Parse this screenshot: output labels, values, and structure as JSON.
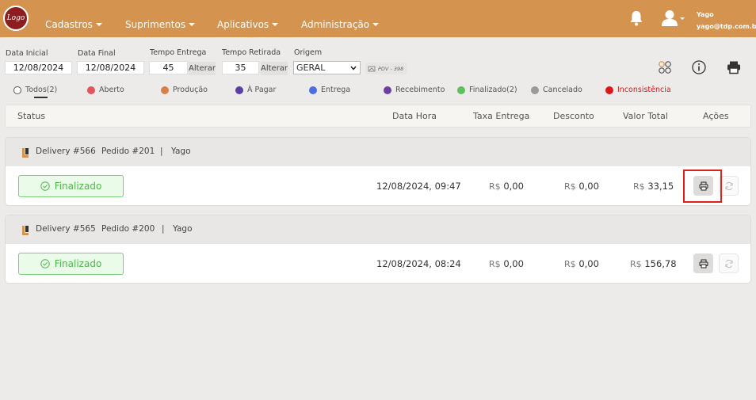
{
  "header": {
    "logo_text": "Logo",
    "menu": [
      "Cadastros",
      "Suprimentos",
      "Aplicativos",
      "Administração"
    ],
    "user_name": "Yago",
    "user_email": "yago@tdp.com.br"
  },
  "filters": {
    "data_inicial_label": "Data Inicial",
    "data_inicial_value": "12/08/2024",
    "data_final_label": "Data Final",
    "data_final_value": "12/08/2024",
    "tempo_entrega_label": "Tempo Entrega",
    "tempo_entrega_value": "45",
    "tempo_retirada_label": "Tempo Retirada",
    "tempo_retirada_value": "35",
    "alterar_label": "Alterar",
    "origem_label": "Origem",
    "origem_value": "GERAL",
    "pdv_label": "PDV - 398"
  },
  "legend": [
    {
      "label": "Todos(2)",
      "color": "#ffffff"
    },
    {
      "label": "Aberto",
      "color": "#e0565a"
    },
    {
      "label": "Produção",
      "color": "#d9804a"
    },
    {
      "label": "À Pagar",
      "color": "#5a3ea8"
    },
    {
      "label": "Entrega",
      "color": "#4a6fe0"
    },
    {
      "label": "Recebimento",
      "color": "#6c3fa0"
    },
    {
      "label": "Finalizado(2)",
      "color": "#5cc05c"
    },
    {
      "label": "Cancelado",
      "color": "#9a9a9a"
    },
    {
      "label": "Inconsistência",
      "color": "#e0151a"
    }
  ],
  "table": {
    "headers": [
      "Status",
      "Data Hora",
      "Taxa Entrega",
      "Desconto",
      "Valor Total",
      "Ações"
    ]
  },
  "orders": [
    {
      "delivery": "Delivery #566",
      "pedido": "Pedido #201",
      "sep": "|",
      "user": "Yago",
      "status": "Finalizado",
      "datetime": "12/08/2024, 09:47",
      "taxa_currency": "R$",
      "taxa": "0,00",
      "desconto_currency": "R$",
      "desconto": "0,00",
      "total_currency": "R$",
      "total": "33,15"
    },
    {
      "delivery": "Delivery #565",
      "pedido": "Pedido #200",
      "sep": "|",
      "user": "Yago",
      "status": "Finalizado",
      "datetime": "12/08/2024, 08:24",
      "taxa_currency": "R$",
      "taxa": "0,00",
      "desconto_currency": "R$",
      "desconto": "0,00",
      "total_currency": "R$",
      "total": "156,78"
    }
  ],
  "colors": {
    "topbar": "#d4944f",
    "finalizado": "#4fb54d",
    "highlight": "#e0201d"
  }
}
